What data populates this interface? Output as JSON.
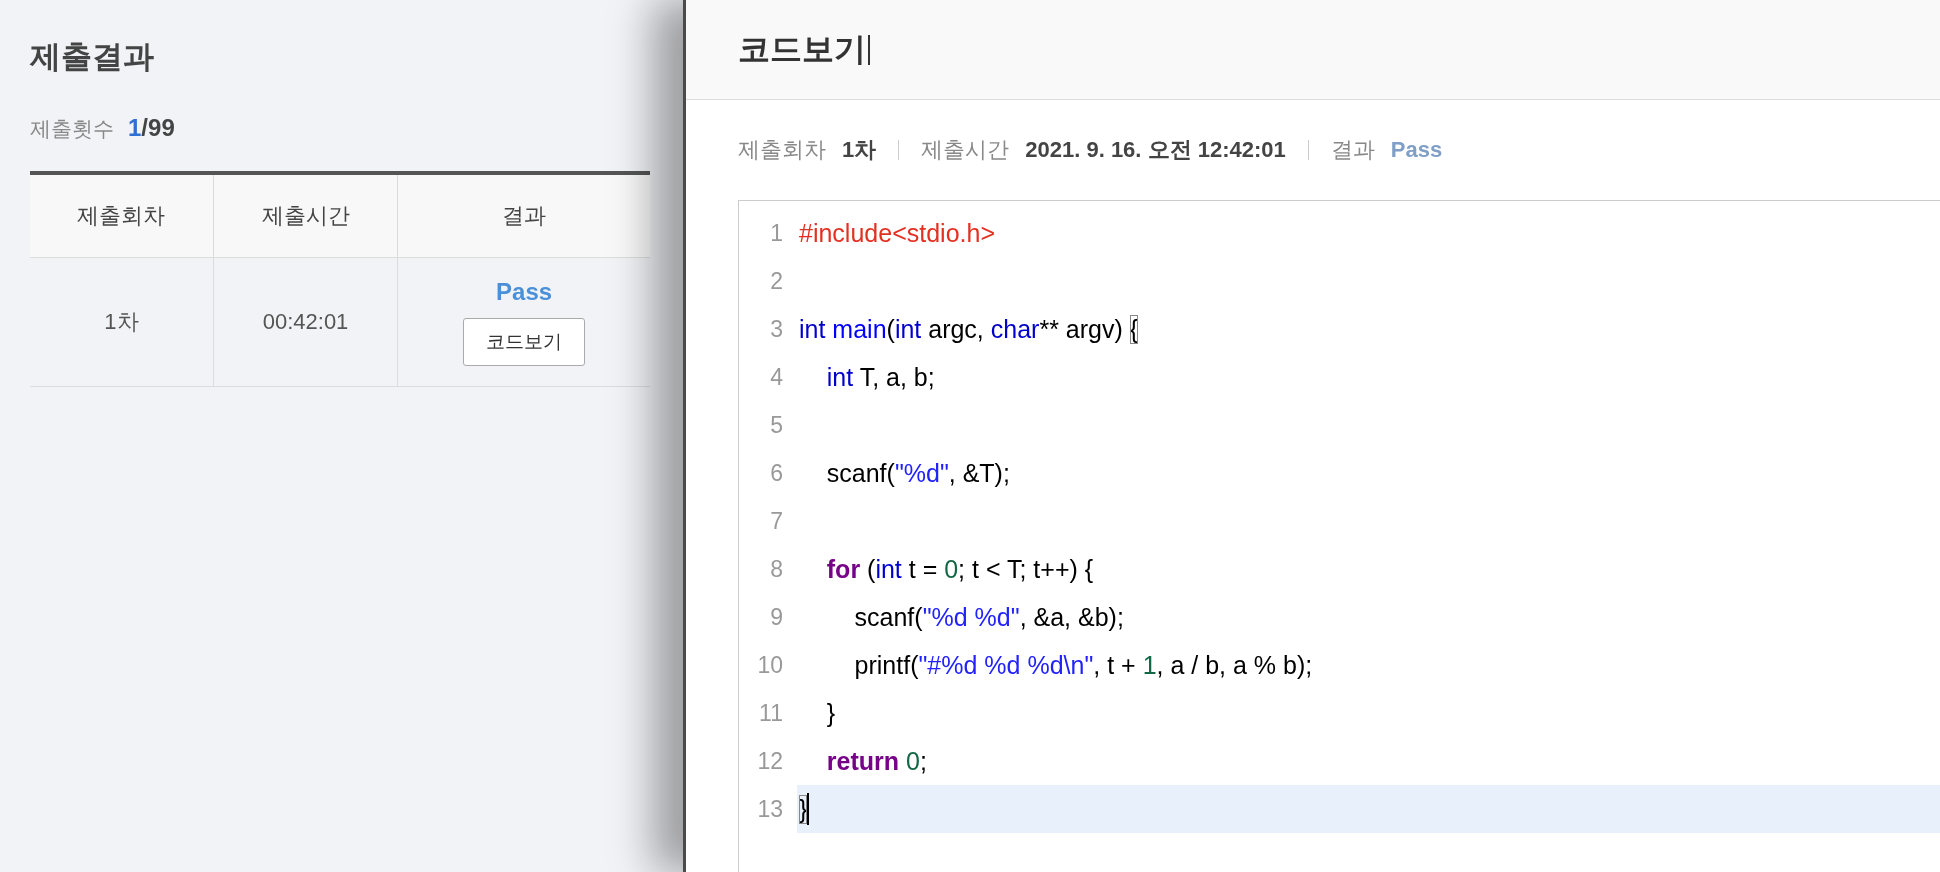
{
  "result_panel": {
    "title": "제출결과",
    "count": {
      "label": "제출횟수",
      "used": "1",
      "total": "/99"
    },
    "table": {
      "columns": [
        "제출회차",
        "제출시간",
        "결과"
      ],
      "rows": [
        {
          "round": "1차",
          "time": "00:42:01",
          "result": "Pass",
          "button": "코드보기"
        }
      ]
    }
  },
  "code_panel": {
    "title": "코드보기",
    "info": [
      {
        "label": "제출회차",
        "value": "1차",
        "kind": "plain"
      },
      {
        "label": "제출시간",
        "value": "2021. 9. 16. 오전 12:42:01",
        "kind": "plain"
      },
      {
        "label": "결과",
        "value": "Pass",
        "kind": "result"
      }
    ],
    "lines": [
      {
        "number": "1",
        "active": false,
        "tokens": [
          {
            "kind": "meta",
            "text": "#include<stdio.h>"
          }
        ]
      },
      {
        "number": "2",
        "active": false
      },
      {
        "number": "3",
        "active": false,
        "tokens": [
          {
            "kind": "type",
            "text": "int"
          },
          {
            "kind": "def",
            "text": " main"
          },
          {
            "kind": "plain",
            "text": "("
          },
          {
            "kind": "type",
            "text": "int"
          },
          {
            "kind": "plain",
            "text": " argc, "
          },
          {
            "kind": "type",
            "text": "char"
          },
          {
            "kind": "plain",
            "text": "** argv) "
          },
          {
            "kind": "bracket",
            "text": "{"
          }
        ]
      },
      {
        "number": "4",
        "active": false,
        "tokens": [
          {
            "kind": "type",
            "text": "    int"
          },
          {
            "kind": "plain",
            "text": " T, a, b;"
          }
        ]
      },
      {
        "number": "5",
        "active": false
      },
      {
        "number": "6",
        "active": false,
        "tokens": [
          {
            "kind": "plain",
            "text": "    scanf("
          },
          {
            "kind": "string",
            "text": "\"%d\""
          },
          {
            "kind": "plain",
            "text": ", &T);"
          }
        ]
      },
      {
        "number": "7",
        "active": false
      },
      {
        "number": "8",
        "active": false,
        "tokens": [
          {
            "kind": "keyword",
            "text": "    for"
          },
          {
            "kind": "plain",
            "text": " ("
          },
          {
            "kind": "type",
            "text": "int"
          },
          {
            "kind": "plain",
            "text": " t = "
          },
          {
            "kind": "number",
            "text": "0"
          },
          {
            "kind": "plain",
            "text": "; t < T; t++) {"
          }
        ]
      },
      {
        "number": "9",
        "active": false,
        "tokens": [
          {
            "kind": "plain",
            "text": "        scanf("
          },
          {
            "kind": "string",
            "text": "\"%d %d\""
          },
          {
            "kind": "plain",
            "text": ", &a, &b);"
          }
        ]
      },
      {
        "number": "10",
        "active": false,
        "tokens": [
          {
            "kind": "plain",
            "text": "        printf("
          },
          {
            "kind": "string",
            "text": "\"#%d %d %d\\n\""
          },
          {
            "kind": "plain",
            "text": ", t + "
          },
          {
            "kind": "number",
            "text": "1"
          },
          {
            "kind": "plain",
            "text": ", a / b, a % b);"
          }
        ]
      },
      {
        "number": "11",
        "active": false,
        "tokens": [
          {
            "kind": "plain",
            "text": "    }"
          }
        ]
      },
      {
        "number": "12",
        "active": false,
        "tokens": [
          {
            "kind": "keyword",
            "text": "    return"
          },
          {
            "kind": "number",
            "text": " 0"
          },
          {
            "kind": "plain",
            "text": ";"
          }
        ]
      },
      {
        "number": "13",
        "active": true,
        "tokens": [
          {
            "kind": "bracket",
            "text": "}"
          }
        ]
      }
    ]
  }
}
